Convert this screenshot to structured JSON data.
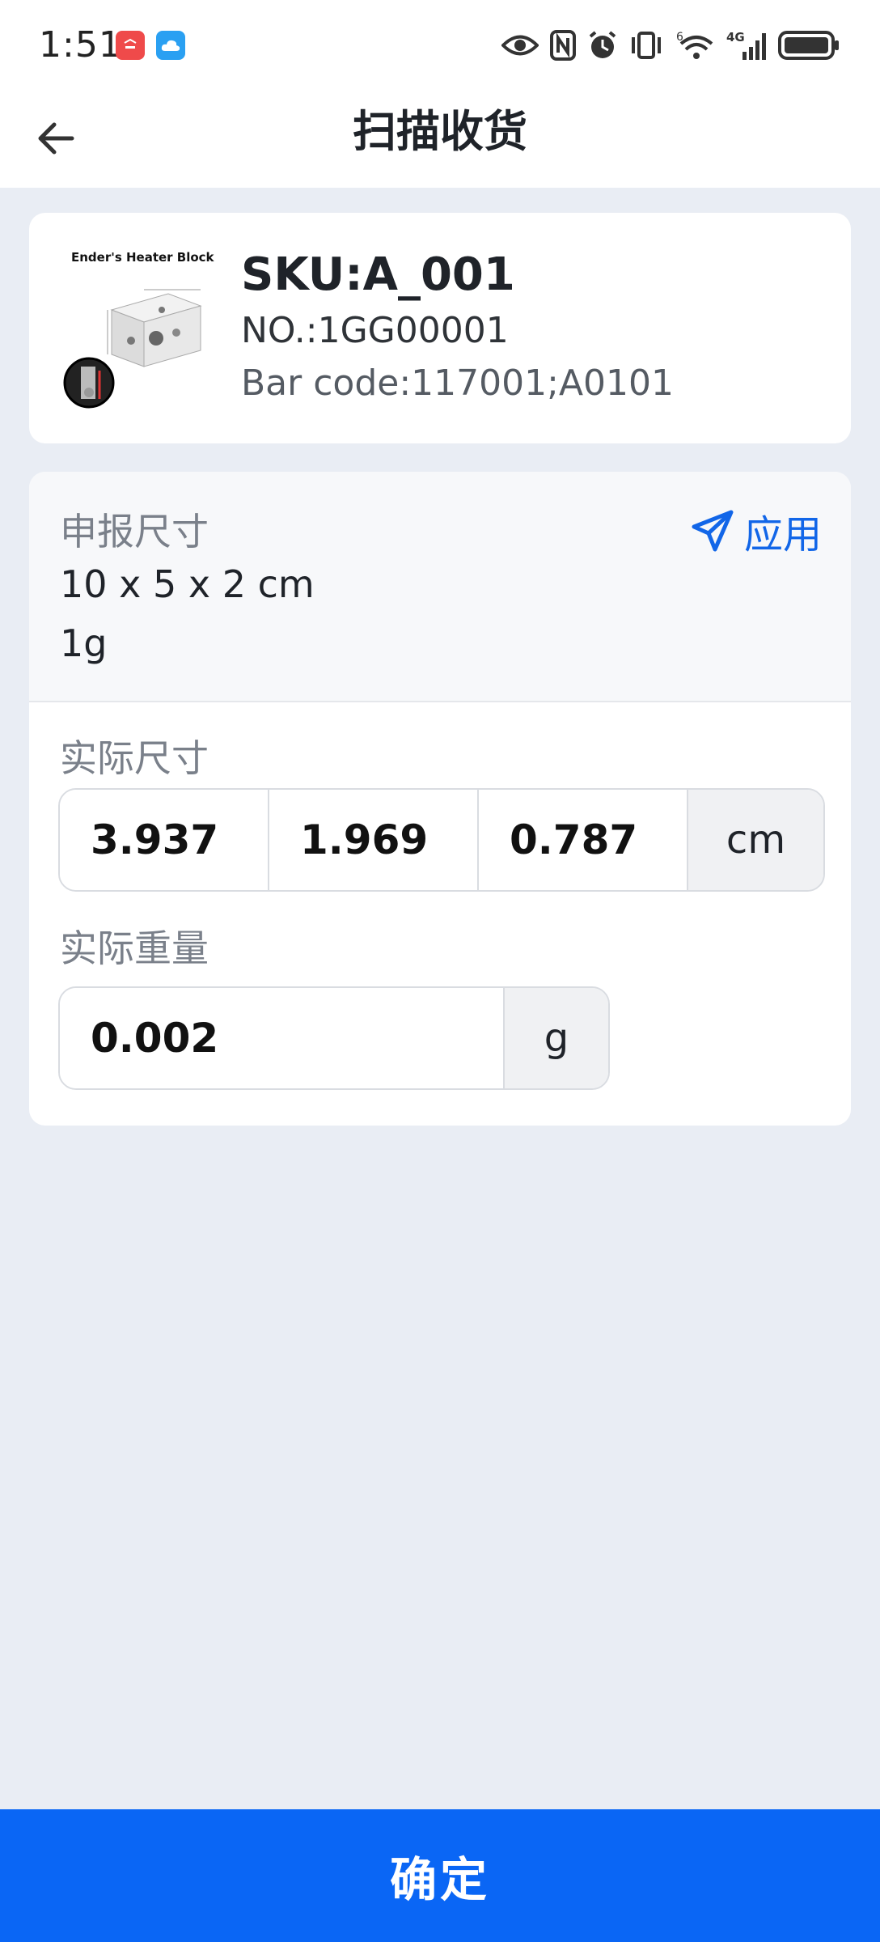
{
  "status_bar": {
    "time": "1:51",
    "network": "4G",
    "icons": [
      "huawei-app-icon",
      "cloud-app-icon",
      "eye-icon",
      "nfc-icon",
      "alarm-icon",
      "vibrate-icon",
      "wifi-icon",
      "signal-icon",
      "battery-icon"
    ]
  },
  "header": {
    "title": "扫描收货"
  },
  "product": {
    "image_caption": "Ender's Heater Block",
    "sku": "SKU:A_001",
    "number": "NO.:1GG00001",
    "barcode": "Bar code:117001;A0101"
  },
  "declared": {
    "label": "申报尺寸",
    "apply_label": "应用",
    "dimensions": "10 x 5 x 2 cm",
    "weight": "1g"
  },
  "actual": {
    "size_label": "实际尺寸",
    "length": "3.937",
    "width": "1.969",
    "height": "0.787",
    "size_unit": "cm",
    "weight_label": "实际重量",
    "weight": "0.002",
    "weight_unit": "g"
  },
  "footer": {
    "confirm_label": "确定"
  },
  "colors": {
    "accent": "#0a66f5",
    "link": "#1266e8",
    "background": "#e9edf4"
  }
}
